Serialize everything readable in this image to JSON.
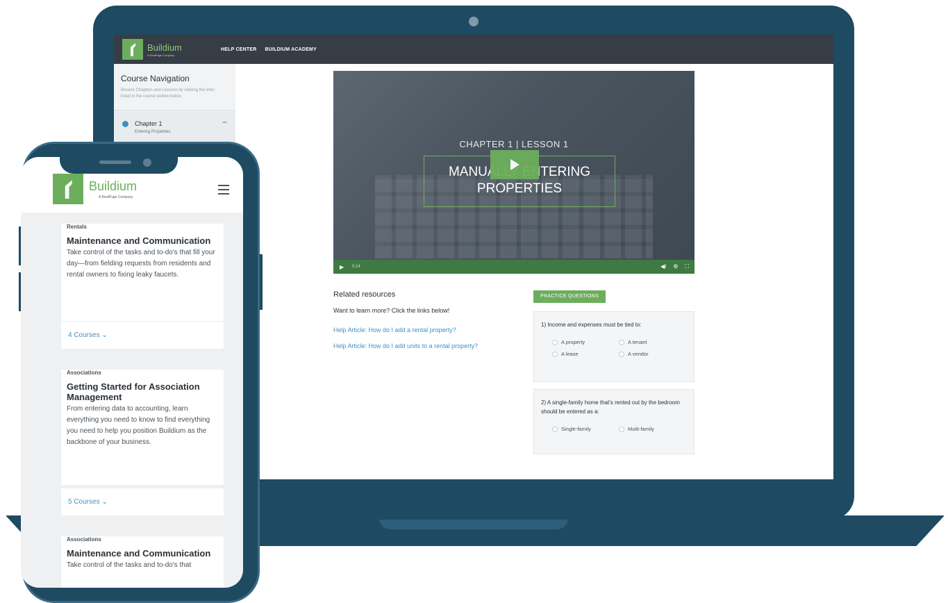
{
  "desktop": {
    "brand": {
      "name": "Buildium",
      "sub": "A RealPage Company"
    },
    "nav": {
      "help_center": "HELP CENTER",
      "academy": "BUILDIUM ACADEMY"
    },
    "course_nav": {
      "title": "Course Navigation",
      "description": "Browse Chapters and Lessons by clicking the links listed in the course outline below.",
      "chapter_title": "Chapter 1",
      "chapter_sub": "Entering Properties",
      "toggle": "−"
    },
    "video": {
      "subtitle": "CHAPTER 1 | LESSON 1",
      "title": "MANUALLY ENTERING PROPERTIES",
      "time": "5:14"
    },
    "related": {
      "title": "Related resources",
      "intro": "Want to learn more? Click the links below!",
      "links": [
        "Help Article: How do I add a rental property?",
        "Help Article: How do I add units to a rental property?"
      ]
    },
    "practice": {
      "button": "PRACTICE QUESTIONS",
      "q1": {
        "text": "1)  Income and expenses must be tied to:",
        "options": [
          "A property",
          "A tenant",
          "A lease",
          "A vendor"
        ]
      },
      "q2": {
        "text": "2)  A single-family home that's rented out by the bedroom should be entered as a:",
        "options": [
          "Single-family",
          "Multi-family"
        ]
      }
    }
  },
  "mobile": {
    "brand": {
      "name": "Buildium",
      "sub": "A RealPage Company"
    },
    "cards": [
      {
        "category": "Rentals",
        "title": "Maintenance and Communication",
        "description": "Take control of the tasks and to-do's that fill your day—from fielding requests from residents and rental owners to fixing leaky faucets.",
        "courses": "4 Courses"
      },
      {
        "category": "Associations",
        "title": "Getting Started for Association Management",
        "description": "From entering data to accounting, learn everything you need to know to find everything you need to help you position Buildium as the backbone of your business.",
        "courses": "5 Courses"
      },
      {
        "category": "Associations",
        "title": "Maintenance and Communication",
        "description": "Take control of the tasks and to-do's that"
      }
    ]
  }
}
